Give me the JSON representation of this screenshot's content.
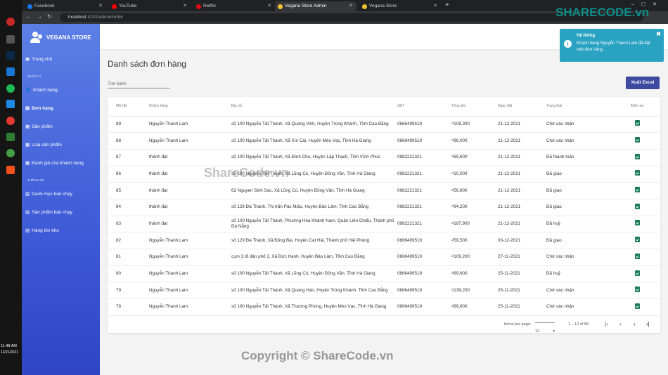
{
  "taskbar": {
    "time": "11:48 AM",
    "date": "12/21/2021"
  },
  "browser": {
    "tabs": [
      {
        "label": "Facebook",
        "color": "#1877f2"
      },
      {
        "label": "YouTube",
        "color": "#ff0000"
      },
      {
        "label": "Netflix",
        "color": "#e50914"
      },
      {
        "label": "Vegana Store Admin",
        "color": "#f2c230"
      },
      {
        "label": "Vegana Store",
        "color": "#f2c230"
      }
    ],
    "active_tab": 3,
    "url_host": "localhost",
    "url_path": ":4201/admin/order"
  },
  "sidebar": {
    "brand": "VEGANA STORE",
    "home": "Trang chủ",
    "section_manage": "QUẢN LÝ",
    "items": [
      "Khách hàng",
      "Đơn hàng",
      "Sản phẩm",
      "Loại sản phẩm",
      "Đánh giá của khách hàng"
    ],
    "section_stats": "THỐNG KÊ",
    "stats": [
      "Danh mục bán chạy",
      "Sản phẩm bán chạy",
      "Hàng tồn kho"
    ]
  },
  "page": {
    "title": "Danh sách đơn hàng",
    "search_placeholder": "Tìm kiếm",
    "export_label": "Xuất Excel"
  },
  "table": {
    "headers": [
      "Mã HĐ",
      "Khách hàng",
      "Địa chỉ",
      "SĐT",
      "Tổng tiền",
      "Ngày đặt",
      "Trạng thái",
      "Kiểm tra"
    ],
    "rows": [
      [
        "89",
        "Nguyễn Thanh Lam",
        "số 100 Nguyễn Tất Thành, Xã Quang Vinh, Huyện Trùng Khánh, Tỉnh Cao Bằng",
        "0866499519",
        "₫108,300",
        "21-12-2021",
        "Chờ xác nhận"
      ],
      [
        "88",
        "Nguyễn Thanh Lam",
        "số 100 Nguyễn Tất Thành, Xã Xín Cái, Huyện Mèo Vạc, Tỉnh Hà Giang",
        "0866499519",
        "₫99,000",
        "21-12-2021",
        "Chờ xác nhận"
      ],
      [
        "87",
        "thành đạt",
        "số 100 Nguyễn Tất Thành, Xã Đình Chu, Huyện Lập Thạch, Tỉnh Vĩnh Phúc",
        "0982221321",
        "₫69,600",
        "21-12-2021",
        "Đã thanh toán"
      ],
      [
        "86",
        "thành đạt",
        "số 100 Nguyễn Tất Thành, Xã Lũng Cú, Huyện Đồng Văn, Tỉnh Hà Giang",
        "0982221321",
        "₫10,000",
        "21-12-2021",
        "Đã giao"
      ],
      [
        "85",
        "thành đạt",
        "62 Nguyen Sinh Sac, Xã Lũng Cú, Huyện Đồng Văn, Tỉnh Hà Giang",
        "0982221321",
        "₫56,800",
        "21-12-2021",
        "Đã giao"
      ],
      [
        "84",
        "thành đạt",
        "số 129 Đà Thành, Thị trấn Pác Miầu, Huyện Bảo Lâm, Tỉnh Cao Bằng",
        "0982221321",
        "₫94,200",
        "21-12-2021",
        "Đã giao"
      ],
      [
        "83",
        "thành đạt",
        "số 100 Nguyễn Tất Thành, Phường Hòa Khánh Nam, Quận Liên Chiểu, Thành phố Đà Nẵng",
        "0982221321",
        "₫187,900",
        "21-12-2021",
        "Đã huỷ"
      ],
      [
        "82",
        "Nguyễn Thanh Lam",
        "số 129 Đà Thành, Xã Đồng Bài, Huyện Cát Hải, Thành phố Hải Phòng",
        "0866499519",
        "₫59,500",
        "03-12-2021",
        "Đã giao"
      ],
      [
        "81",
        "Nguyễn Thanh Lam",
        "cụm 3 tổ dân phố 2, Xã Đức Hạnh, Huyện Bảo Lâm, Tỉnh Cao Bằng",
        "0866499519",
        "₫109,200",
        "27-11-2021",
        "Chờ xác nhận"
      ],
      [
        "80",
        "Nguyễn Thanh Lam",
        "số 100 Nguyễn Tất Thành, Xã Lũng Cú, Huyện Đồng Văn, Tỉnh Hà Giang",
        "0866499519",
        "₫69,600",
        "25-11-2021",
        "Đã huỷ"
      ],
      [
        "79",
        "Nguyễn Thanh Lam",
        "số 100 Nguyễn Tất Thành, Xã Quang Hán, Huyện Trùng Khánh, Tỉnh Cao Bằng",
        "0866499519",
        "₫139,200",
        "25-11-2021",
        "Chờ xác nhận"
      ],
      [
        "78",
        "Nguyễn Thanh Lam",
        "số 100 Nguyễn Tất Thành, Xã Thượng Phùng, Huyện Mèo Vạc, Tỉnh Hà Giang",
        "0866499519",
        "₫99,600",
        "25-11-2021",
        "Chờ xác nhận"
      ]
    ]
  },
  "pager": {
    "label": "Items per page:",
    "size": "12",
    "range": "1 – 12 of 88"
  },
  "notification": {
    "title": "Hệ thống",
    "message": "Khách hàng Nguyễn Thanh Lam đã đặt một đơn hàng"
  },
  "watermark": {
    "logo": "SHARECODE.vn",
    "center": "ShareCode.vn",
    "bottom": "Copyright © ShareCode.vn"
  }
}
